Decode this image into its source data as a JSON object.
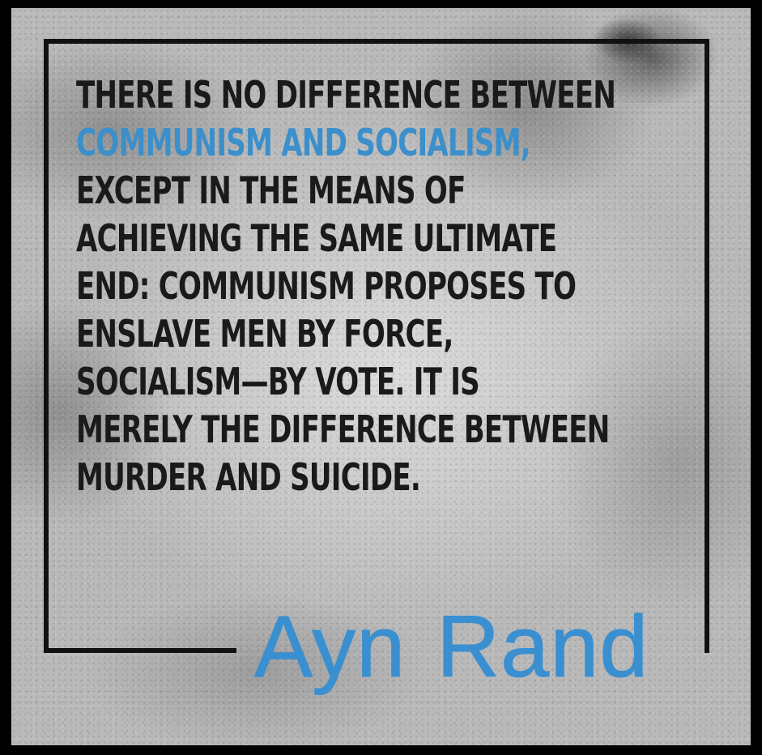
{
  "quote": {
    "lines": [
      {
        "text": "THERE IS NO DIFFERENCE BETWEEN",
        "accent": false
      },
      {
        "text": "COMMUNISM AND SOCIALISM,",
        "accent": true
      },
      {
        "text": "EXCEPT IN THE MEANS OF",
        "accent": false
      },
      {
        "text": "ACHIEVING THE SAME ULTIMATE",
        "accent": false
      },
      {
        "text": "END: COMMUNISM PROPOSES TO",
        "accent": false
      },
      {
        "text": "ENSLAVE MEN BY FORCE,",
        "accent": false
      },
      {
        "text": "SOCIALISM—BY VOTE. IT IS",
        "accent": false
      },
      {
        "text": "MERELY THE DIFFERENCE BETWEEN",
        "accent": false
      },
      {
        "text": "MURDER AND SUICIDE.",
        "accent": false
      }
    ]
  },
  "author": {
    "first": "Ayn",
    "last": "Rand"
  },
  "colors": {
    "accent": "#3b8fcb",
    "text": "#1a1a1a",
    "frame": "#111111",
    "background": "#c4c4c4"
  }
}
